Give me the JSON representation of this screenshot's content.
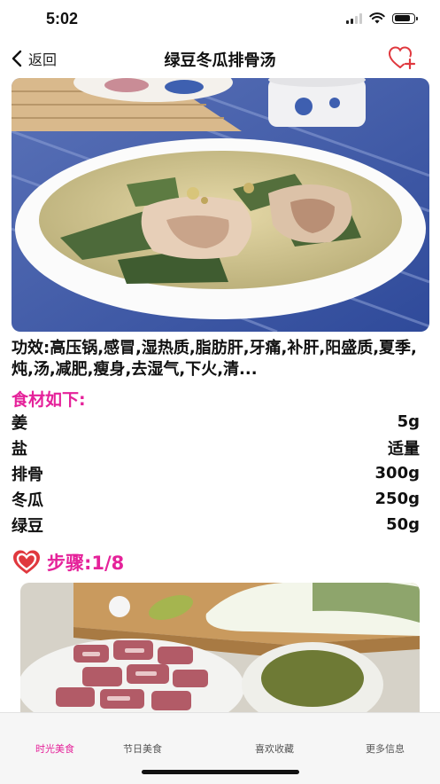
{
  "status": {
    "time": "5:02",
    "battery_level": 0.85
  },
  "nav": {
    "back_label": "返回",
    "title": "绿豆冬瓜排骨汤"
  },
  "recipe": {
    "effects": "功效:高压锅,感冒,湿热质,脂肪肝,牙痛,补肝,阳盛质,夏季,炖,汤,减肥,瘦身,去湿气,下火,清...",
    "ingredients_title": "食材如下:",
    "ingredients": [
      {
        "name": "姜",
        "amount": "5g"
      },
      {
        "name": "盐",
        "amount": "适量"
      },
      {
        "name": "排骨",
        "amount": "300g"
      },
      {
        "name": "冬瓜",
        "amount": "250g"
      },
      {
        "name": "绿豆",
        "amount": "50g"
      }
    ],
    "steps_label": "步骤:1/8"
  },
  "tabs": [
    {
      "label": "时光美食",
      "active": true
    },
    {
      "label": "节日美食",
      "active": false
    },
    {
      "label": "喜欢收藏",
      "active": false
    },
    {
      "label": "更多信息",
      "active": false
    }
  ],
  "colors": {
    "accent": "#e5229a",
    "heart": "#e0383e"
  }
}
